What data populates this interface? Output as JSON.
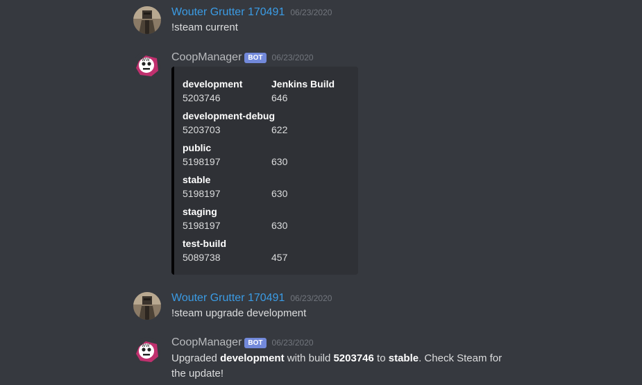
{
  "colors": {
    "background": "#36393f",
    "user_name": "#3b9ce5",
    "bot_name": "#b9bbbe",
    "bot_tag": "#7289da",
    "embed_background": "#2f3136",
    "embed_border": "#040405"
  },
  "messages": [
    {
      "author": "Wouter Grutter 170491",
      "timestamp": "06/23/2020",
      "text": "!steam current",
      "avatar": "soldier-avatar"
    },
    {
      "author": "CoopManager",
      "tag": "BOT",
      "timestamp": "06/23/2020",
      "avatar": "skull-logo-avatar",
      "embed": {
        "header_col1": "development",
        "header_col2": "Jenkins Build",
        "fields": [
          {
            "name": "development",
            "steam_build": "5203746",
            "jenkins_build": "646"
          },
          {
            "name": "development-debug",
            "steam_build": "5203703",
            "jenkins_build": "622"
          },
          {
            "name": "public",
            "steam_build": "5198197",
            "jenkins_build": "630"
          },
          {
            "name": "stable",
            "steam_build": "5198197",
            "jenkins_build": "630"
          },
          {
            "name": "staging",
            "steam_build": "5198197",
            "jenkins_build": "630"
          },
          {
            "name": "test-build",
            "steam_build": "5089738",
            "jenkins_build": "457"
          }
        ]
      }
    },
    {
      "author": "Wouter Grutter 170491",
      "timestamp": "06/23/2020",
      "text": "!steam upgrade development",
      "avatar": "soldier-avatar"
    },
    {
      "author": "CoopManager",
      "tag": "BOT",
      "timestamp": "06/23/2020",
      "avatar": "skull-logo-avatar",
      "text_parts": {
        "p1": "Upgraded ",
        "b1": "development",
        "p2": " with build ",
        "b2": "5203746",
        "p3": " to ",
        "b3": "stable",
        "p4": ". Check Steam for the update!"
      }
    }
  ]
}
